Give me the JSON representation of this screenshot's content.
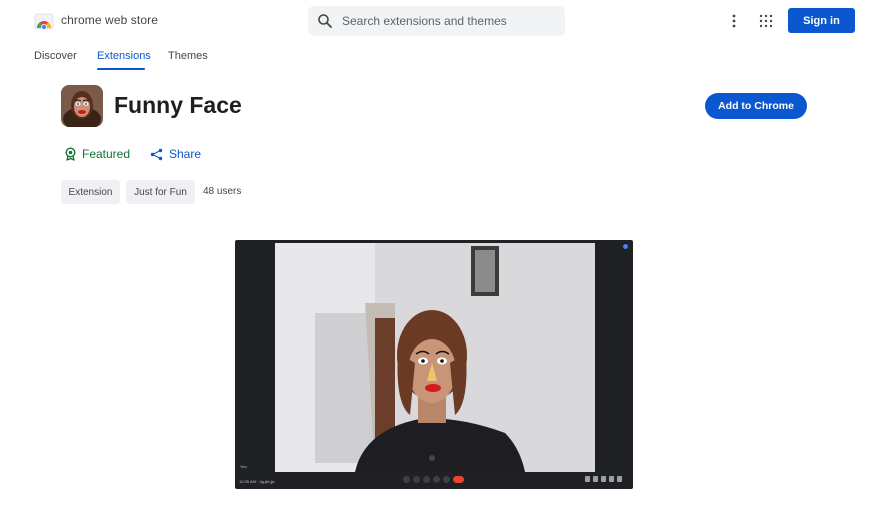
{
  "header": {
    "brand": "chrome web store",
    "search_placeholder": "Search extensions and themes",
    "signin_label": "Sign in"
  },
  "nav": {
    "tabs": [
      {
        "label": "Discover",
        "active": false
      },
      {
        "label": "Extensions",
        "active": true
      },
      {
        "label": "Themes",
        "active": false
      }
    ]
  },
  "item": {
    "title": "Funny Face",
    "add_label": "Add to Chrome",
    "featured_label": "Featured",
    "share_label": "Share",
    "chips": [
      "Extension",
      "Just for Fun"
    ],
    "users": "48 users"
  },
  "colors": {
    "accent": "#0b57d0",
    "featured": "#137333",
    "chip_bg": "#eef0f3"
  },
  "icons": [
    "chrome-web-store-logo",
    "search-icon",
    "more-vert-icon",
    "apps-grid-icon",
    "featured-badge-icon",
    "share-icon"
  ]
}
